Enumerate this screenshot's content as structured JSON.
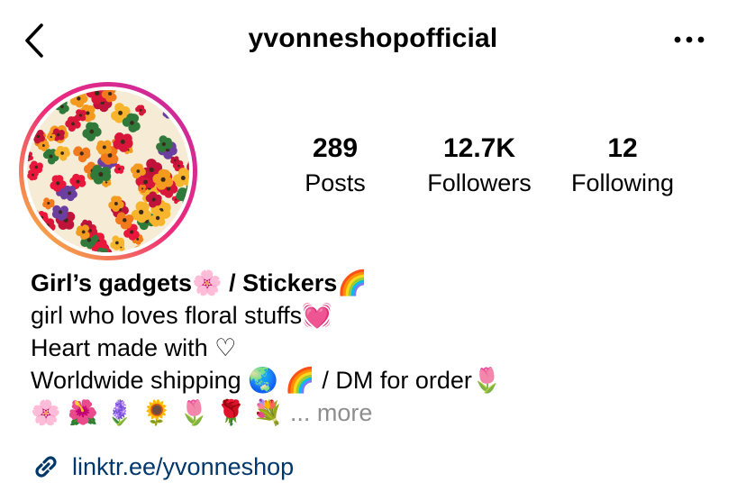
{
  "header": {
    "username": "yvonneshopofficial",
    "back_icon": "chevron-left-icon",
    "more_icon": "more-horizontal-icon"
  },
  "avatar": {
    "description_icon": "floral-avatar",
    "ring_colors": [
      "#f9ce34",
      "#ee2a7b",
      "#6228d7"
    ]
  },
  "stats": {
    "posts": {
      "count": "289",
      "label": "Posts"
    },
    "followers": {
      "count": "12.7K",
      "label": "Followers"
    },
    "following": {
      "count": "12",
      "label": "Following"
    }
  },
  "bio": {
    "name": "Girl’s gadgets🌸 / Stickers🌈",
    "line1": "girl who loves floral stuffs💓",
    "line2": "Heart made with ♡",
    "line3": "Worldwide shipping 🌏 🌈 / DM for order🌷",
    "line4_emojis": "🌸 🌺 🪻 🌻 🌷 🌹 💐",
    "more_label": "... more"
  },
  "link": {
    "icon": "link-icon",
    "text": "linktr.ee/yvonneshop",
    "color": "#00376b"
  }
}
